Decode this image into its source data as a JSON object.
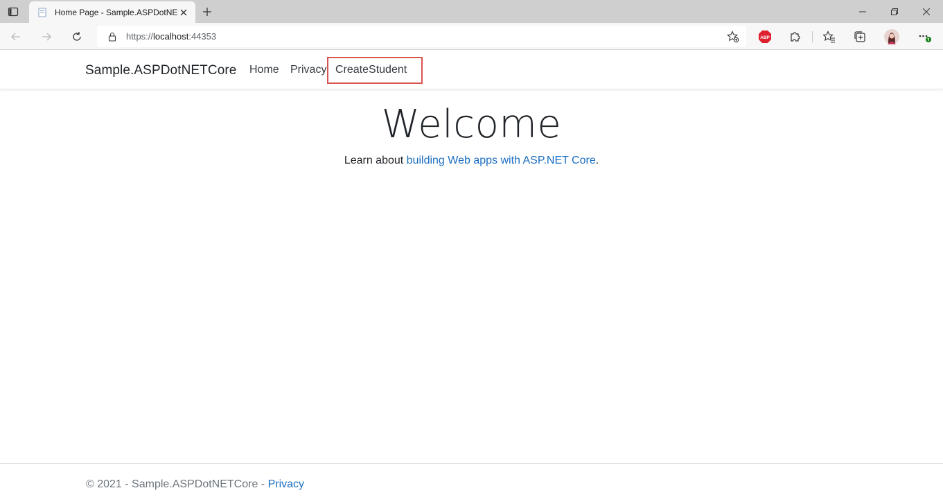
{
  "browser": {
    "tab_title": "Home Page - Sample.ASPDotNETCore",
    "url_scheme": "https://",
    "url_host": "localhost",
    "url_port": ":44353",
    "extension_abp_label": "ABP"
  },
  "page": {
    "brand": "Sample.ASPDotNETCore",
    "nav": {
      "home": "Home",
      "privacy": "Privacy",
      "create_student": "CreateStudent"
    },
    "welcome": "Welcome",
    "learn_prefix": "Learn about ",
    "learn_link": "building Web apps with ASP.NET Core",
    "learn_suffix": ".",
    "footer_text": "© 2021 - Sample.ASPDotNETCore - ",
    "footer_link": "Privacy"
  },
  "colors": {
    "link": "#1b6ec2",
    "highlight": "#d9534f"
  }
}
